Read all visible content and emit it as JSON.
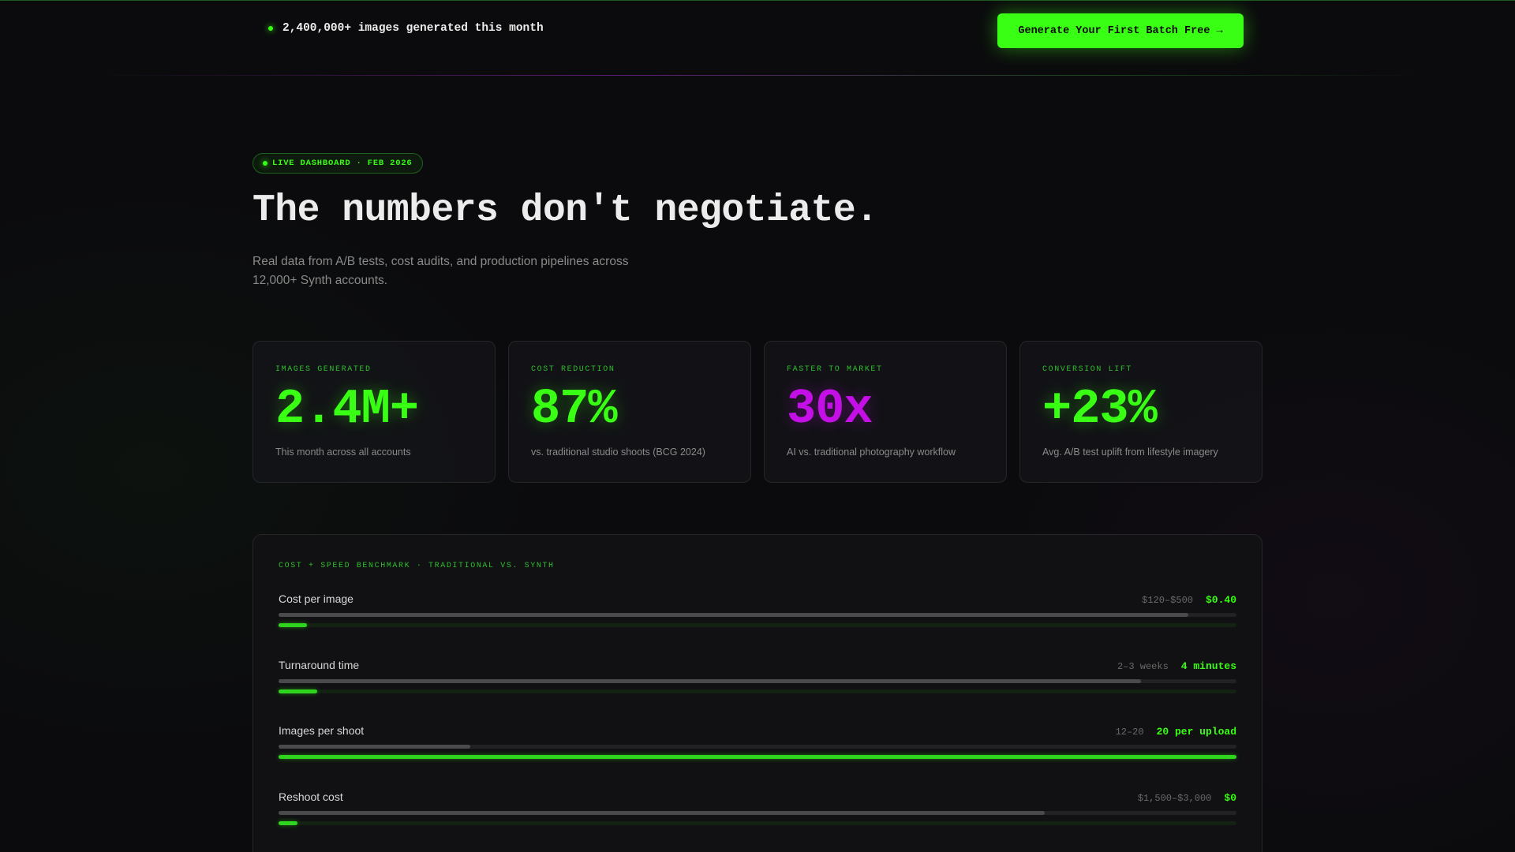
{
  "topbar": {
    "live_stat": "2,400,000+ images generated this month",
    "cta_label": "Generate Your First Batch Free →"
  },
  "hero": {
    "badge": "LIVE DASHBOARD · FEB 2026",
    "title": "The numbers don't negotiate.",
    "subtitle": "Real data from A/B tests, cost audits, and production pipelines across 12,000+ Synth accounts."
  },
  "stats": [
    {
      "label": "IMAGES GENERATED",
      "value": "2.4M+",
      "description": "This month across all accounts",
      "color": "#39ff14"
    },
    {
      "label": "COST REDUCTION",
      "value": "87%",
      "description": "vs. traditional studio shoots (BCG 2024)",
      "color": "#39ff14"
    },
    {
      "label": "FASTER TO MARKET",
      "value": "30x",
      "description": "AI vs. traditional photography workflow",
      "color": "#c40fe6"
    },
    {
      "label": "CONVERSION LIFT",
      "value": "+23%",
      "description": "Avg. A/B test uplift from lifestyle imagery",
      "color": "#39ff14"
    }
  ],
  "benchmark": {
    "title": "COST + SPEED BENCHMARK · TRADITIONAL VS. SYNTH",
    "rows": [
      {
        "label": "Cost per image",
        "traditional": "$120–$500",
        "synth": "$0.40",
        "traditional_fill": 0.95,
        "synth_fill": 0.03
      },
      {
        "label": "Turnaround time",
        "traditional": "2–3 weeks",
        "synth": "4 minutes",
        "traditional_fill": 0.9,
        "synth_fill": 0.04
      },
      {
        "label": "Images per shoot",
        "traditional": "12–20",
        "synth": "20 per upload",
        "traditional_fill": 0.2,
        "synth_fill": 1.0
      },
      {
        "label": "Reshoot cost",
        "traditional": "$1,500–$3,000",
        "synth": "$0",
        "traditional_fill": 0.8,
        "synth_fill": 0.02
      }
    ]
  },
  "colors": {
    "accent": "#39ff14",
    "purple": "#c40fe6",
    "background": "#0b0b0d"
  }
}
